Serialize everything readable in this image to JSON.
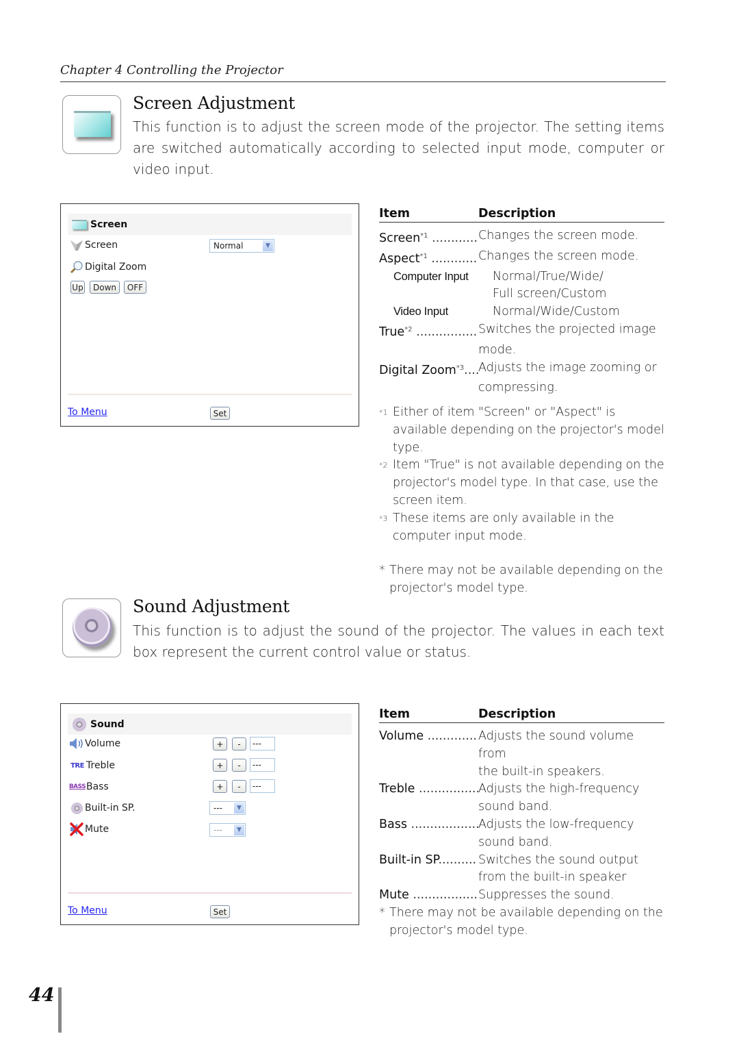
{
  "chapter_header": "Chapter 4 Controlling the Projector",
  "page_number": "44",
  "screen_section": {
    "icon": "screen-icon",
    "title": "Screen Adjustment",
    "intro": "This function is to adjust the screen mode of the projector. The setting items are switched automatically according to selected input mode, computer or video input.",
    "panel": {
      "header_icon": "screen-icon",
      "header_label": "Screen",
      "rows": [
        {
          "icon": "screen-mode-icon",
          "label": "Screen",
          "control": "select",
          "value": "Normal"
        },
        {
          "icon": "magnifier-icon",
          "label": "Digital Zoom"
        }
      ],
      "buttons": [
        "Up",
        "Down",
        "OFF"
      ],
      "to_menu_label": "To Menu",
      "set_label": "Set"
    },
    "table": {
      "col_item": "Item",
      "col_description": "Description",
      "rows": [
        {
          "term": "Screen",
          "sup": "*1",
          "dots": "............",
          "def": "Changes the screen mode."
        },
        {
          "term": "Aspect",
          "sup": "*1",
          "dots": "............",
          "def": "Changes the screen mode."
        },
        {
          "sub_term": "Computer Input",
          "def": "Normal/True/Wide/"
        },
        {
          "sub_term": "",
          "def": "Full screen/Custom"
        },
        {
          "sub_term": "Video Input",
          "def": "Normal/Wide/Custom"
        },
        {
          "term": "True",
          "sup": "*2",
          "dots": "................",
          "def": "Switches the projected image"
        },
        {
          "term": "",
          "def": "mode."
        },
        {
          "term": "Digital Zoom",
          "sup": "*3",
          "dots": "....",
          "def": "Adjusts the image zooming or"
        },
        {
          "term": "",
          "def": "compressing."
        }
      ]
    },
    "footnotes": [
      {
        "mark": "*1",
        "text": "Either  of item \"Screen\" or \"Aspect\" is available depending on the projector's model type."
      },
      {
        "mark": "*2",
        "text": "Item \"True\" is not available depending on the projector's model type. In that case, use the screen item."
      },
      {
        "mark": "*3",
        "text": "These items are only available in the computer input mode."
      }
    ],
    "note": {
      "mark": "*",
      "text": "There may not be available depending on the projector's model type."
    }
  },
  "sound_section": {
    "icon": "speaker-icon",
    "title": "Sound Adjustment",
    "intro": "This function is to adjust the sound of the projector.  The values in each text box represent the current control value or status.",
    "panel": {
      "header_icon": "speaker-icon",
      "header_label": "Sound",
      "rows": [
        {
          "icon": "volume-icon",
          "label": "Volume",
          "control": "stepper",
          "plus": "+",
          "minus": "-",
          "value": "---"
        },
        {
          "icon": "treble-icon",
          "icon_text": "TRE",
          "label": "Treble",
          "control": "stepper",
          "plus": "+",
          "minus": "-",
          "value": "---"
        },
        {
          "icon": "bass-icon",
          "icon_text": "BASS",
          "label": "Bass",
          "control": "stepper",
          "plus": "+",
          "minus": "-",
          "value": "---"
        },
        {
          "icon": "builtin-speaker-icon",
          "label": "Built-in SP.",
          "control": "select",
          "value": "---"
        },
        {
          "icon": "mute-icon",
          "label": "Mute",
          "control": "select",
          "value": "---"
        }
      ],
      "to_menu_label": "To Menu",
      "set_label": "Set"
    },
    "table": {
      "col_item": "Item",
      "col_description": "Description",
      "rows": [
        {
          "term": "Volume",
          "dots": "..............",
          "def": "Adjusts the sound volume from"
        },
        {
          "term": "",
          "def": "the built-in speakers."
        },
        {
          "term": "Treble",
          "dots": "................",
          "def": "Adjusts the high-frequency"
        },
        {
          "term": "",
          "def": "sound band."
        },
        {
          "term": "Bass",
          "dots": "..................",
          "def": "Adjusts the low-frequency"
        },
        {
          "term": "",
          "def": "sound band."
        },
        {
          "term": "Built-in SP",
          "dots": "..........",
          "def": "Switches the sound output"
        },
        {
          "term": "",
          "def": "from the built-in speaker"
        },
        {
          "term": "Mute",
          "dots": "..................",
          "def": "Suppresses the sound."
        }
      ]
    },
    "note": {
      "mark": "*",
      "text": "There may not be available depending on the projector's model type."
    }
  }
}
